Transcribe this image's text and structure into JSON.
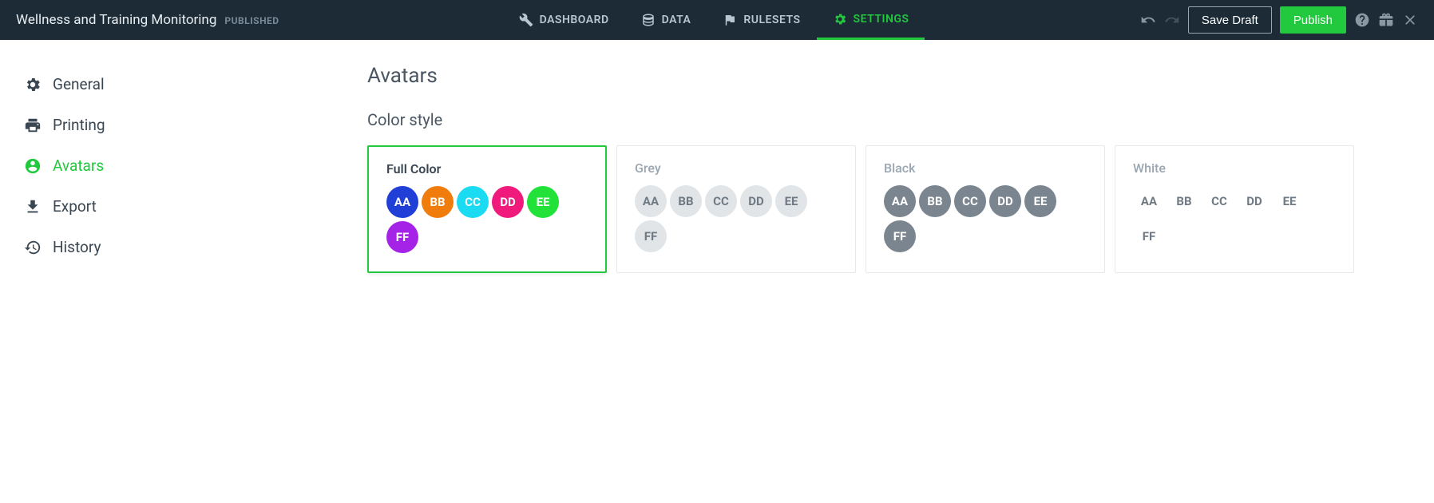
{
  "header": {
    "title": "Wellness and Training Monitoring",
    "status": "PUBLISHED",
    "nav": {
      "dashboard": "DASHBOARD",
      "data": "DATA",
      "rulesets": "RULESETS",
      "settings": "SETTINGS"
    },
    "save_draft": "Save Draft",
    "publish": "Publish"
  },
  "sidebar": {
    "general": "General",
    "printing": "Printing",
    "avatars": "Avatars",
    "export": "Export",
    "history": "History"
  },
  "page": {
    "title": "Avatars",
    "section": "Color style"
  },
  "styles": {
    "full_color": {
      "label": "Full Color",
      "swatches": [
        {
          "t": "AA",
          "bg": "#1f3fd6",
          "fg": "#fff"
        },
        {
          "t": "BB",
          "bg": "#f07c0b",
          "fg": "#fff"
        },
        {
          "t": "CC",
          "bg": "#1adbf2",
          "fg": "#fff"
        },
        {
          "t": "DD",
          "bg": "#ef1a7b",
          "fg": "#fff"
        },
        {
          "t": "EE",
          "bg": "#22e23a",
          "fg": "#fff"
        },
        {
          "t": "FF",
          "bg": "#a423e6",
          "fg": "#fff"
        }
      ]
    },
    "grey": {
      "label": "Grey",
      "swatches": [
        {
          "t": "AA",
          "bg": "#e2e5e8",
          "fg": "#6f7a84"
        },
        {
          "t": "BB",
          "bg": "#e2e5e8",
          "fg": "#6f7a84"
        },
        {
          "t": "CC",
          "bg": "#e2e5e8",
          "fg": "#6f7a84"
        },
        {
          "t": "DD",
          "bg": "#e2e5e8",
          "fg": "#6f7a84"
        },
        {
          "t": "EE",
          "bg": "#e2e5e8",
          "fg": "#6f7a84"
        },
        {
          "t": "FF",
          "bg": "#e2e5e8",
          "fg": "#6f7a84"
        }
      ]
    },
    "black": {
      "label": "Black",
      "swatches": [
        {
          "t": "AA",
          "bg": "#7a8590",
          "fg": "#fff"
        },
        {
          "t": "BB",
          "bg": "#7a8590",
          "fg": "#fff"
        },
        {
          "t": "CC",
          "bg": "#7a8590",
          "fg": "#fff"
        },
        {
          "t": "DD",
          "bg": "#7a8590",
          "fg": "#fff"
        },
        {
          "t": "EE",
          "bg": "#7a8590",
          "fg": "#fff"
        },
        {
          "t": "FF",
          "bg": "#7a8590",
          "fg": "#fff"
        }
      ]
    },
    "white": {
      "label": "White",
      "swatches": [
        {
          "t": "AA",
          "bg": "#ffffff",
          "fg": "#6f7a84"
        },
        {
          "t": "BB",
          "bg": "#ffffff",
          "fg": "#6f7a84"
        },
        {
          "t": "CC",
          "bg": "#ffffff",
          "fg": "#6f7a84"
        },
        {
          "t": "DD",
          "bg": "#ffffff",
          "fg": "#6f7a84"
        },
        {
          "t": "EE",
          "bg": "#ffffff",
          "fg": "#6f7a84"
        },
        {
          "t": "FF",
          "bg": "#ffffff",
          "fg": "#6f7a84"
        }
      ]
    }
  }
}
